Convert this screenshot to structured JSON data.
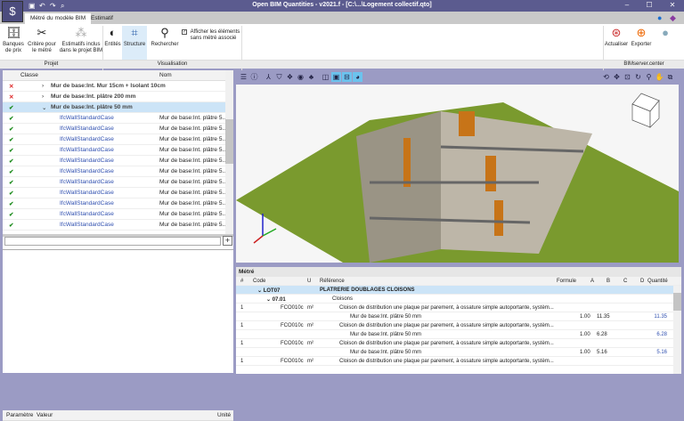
{
  "window": {
    "title": "Open BIM Quantities - v2021.f - [C:\\...\\Logement collectif.qto]",
    "min": "–",
    "max": "☐",
    "close": "✕"
  },
  "quick_access": {
    "save": "💾",
    "undo": "↶",
    "redo": "↷",
    "search": "🔍"
  },
  "tabs": [
    {
      "label": "Métré du modèle BIM"
    },
    {
      "label": "Estimatif"
    }
  ],
  "ribbon": {
    "projet": {
      "label": "Projet",
      "buttons": [
        {
          "label": "Banques\nde prix"
        },
        {
          "label": "Critère pour\nle métré"
        },
        {
          "label": "Estimatifs inclus\ndans le projet BIM"
        }
      ]
    },
    "visualisation": {
      "label": "Visualisation",
      "buttons": [
        {
          "label": "Entités"
        },
        {
          "label": "Structure"
        },
        {
          "label": "Rechercher"
        }
      ],
      "checkbox": "Afficher les éléments\nsans métré associé",
      "checkbox_checked": true
    },
    "bimserver": {
      "label": "BIMserver.center",
      "buttons": [
        {
          "label": "Actualiser"
        },
        {
          "label": "Exporter"
        }
      ]
    }
  },
  "tree": {
    "headers": {
      "classe": "Classe",
      "nom": "Nom"
    },
    "parents": [
      {
        "status": "error",
        "label": "Mur de base:Int. Mur 15cm + Isolant 10cm",
        "expanded": false
      },
      {
        "status": "ok",
        "label": "Mur de base:Int. plâtre 200 mm",
        "expanded": false,
        "status_alt": "error"
      },
      {
        "status": "ok",
        "label": "Mur de base:Int. plâtre 50 mm",
        "expanded": true
      }
    ],
    "child_class": "IfcWallStandardCase",
    "child_name": "Mur de base:Int. plâtre 5...",
    "child_count": 11
  },
  "params": {
    "headers": {
      "param": "Paramètre",
      "valeur": "Valeur",
      "unite": "Unité"
    },
    "add": "+"
  },
  "metre": {
    "title": "Métré",
    "headers": {
      "num": "#",
      "code": "Code",
      "u": "U",
      "ref": "Référence",
      "formule": "Formule",
      "a": "A",
      "b": "B",
      "c": "C",
      "d": "D",
      "qte": "Quantité"
    },
    "lot": {
      "code": "LOT07",
      "ref": "PLATRERIE DOUBLAGES CLOISONS"
    },
    "chapter": {
      "code": "07.01",
      "ref": "Cloisons"
    },
    "items": [
      {
        "num": "1",
        "code": "FCO010c",
        "u": "m²",
        "ref": "Cloison de distribution une plaque par parement, à ossature simple autoportante, systèm...",
        "sub": "Mur de base:Int. plâtre 50 mm",
        "a": "1.00",
        "b": "11.35",
        "qte": "11.35"
      },
      {
        "num": "1",
        "code": "FCO010c",
        "u": "m²",
        "ref": "Cloison de distribution une plaque par parement, à ossature simple autoportante, systèm...",
        "sub": "Mur de base:Int. plâtre 50 mm",
        "a": "1.00",
        "b": "6.28",
        "qte": "6.28"
      },
      {
        "num": "1",
        "code": "FCO010c",
        "u": "m²",
        "ref": "Cloison de distribution une plaque par parement, à ossature simple autoportante, systèm...",
        "sub": "Mur de base:Int. plâtre 50 mm",
        "a": "1.00",
        "b": "5.16",
        "qte": "5.16"
      },
      {
        "num": "1",
        "code": "FCO010c",
        "u": "m²",
        "ref": "Cloison de distribution une plaque par parement, à ossature simple autoportante, systèm...",
        "sub": "",
        "a": "",
        "b": "",
        "qte": ""
      }
    ]
  }
}
